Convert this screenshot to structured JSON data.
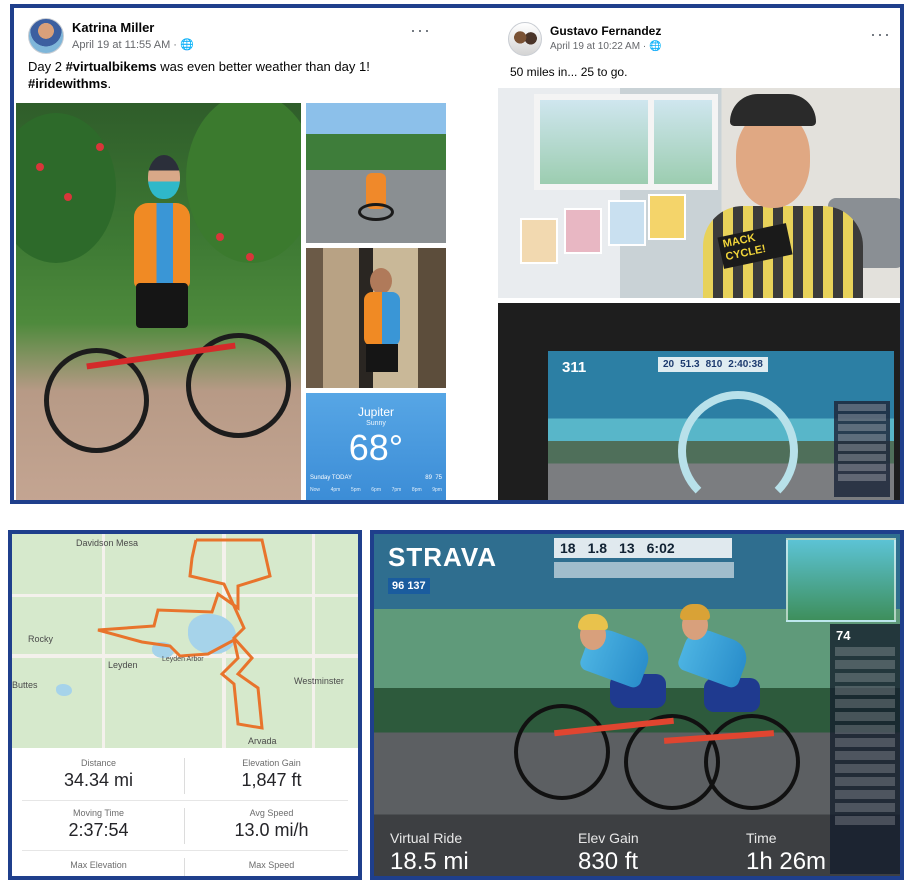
{
  "posts": [
    {
      "author": "Katrina Miller",
      "timestamp": "April 19 at 11:55 AM · ",
      "privacy_icon": "globe-icon",
      "more_label": "···",
      "text_prefix": "Day 2 ",
      "hashtag_1": "#virtualbikems",
      "text_middle": " was even better weather than day 1!",
      "hashtag_2": "#iridewithms",
      "text_suffix": ".",
      "weather": {
        "city": "Jupiter",
        "condition": "Sunny",
        "temperature": "68°",
        "day": "Sunday TODAY",
        "high": "89",
        "low": "75",
        "hours": [
          "Now",
          "4pm",
          "5pm",
          "6pm",
          "7pm",
          "8pm",
          "9pm"
        ]
      }
    },
    {
      "author": "Gustavo Fernandez",
      "timestamp": "April 19 at 10:22 AM · ",
      "privacy_icon": "globe-icon",
      "more_label": "···",
      "text": "50 miles in... 25 to go.",
      "shirt_text": "MACK CYCLE!",
      "hud": {
        "power": "311",
        "speed": "20",
        "distance": "51.3",
        "elevation": "810",
        "time": "2:40:38"
      }
    }
  ],
  "map_card": {
    "labels": [
      "Davidson Mesa",
      "Rocky",
      "Leyden",
      "Leyden Arbor",
      "Westminster",
      "Arvada",
      "Buttes"
    ],
    "route_color": "#e8742c",
    "stats": [
      {
        "label": "Distance",
        "value": "34.34 mi"
      },
      {
        "label": "Elevation Gain",
        "value": "1,847 ft"
      },
      {
        "label": "Moving Time",
        "value": "2:37:54"
      },
      {
        "label": "Avg Speed",
        "value": "13.0 mi/h"
      },
      {
        "label": "Max Elevation",
        "value": ""
      },
      {
        "label": "Max Speed",
        "value": ""
      }
    ]
  },
  "strava_card": {
    "logo": "STRAVA",
    "hud_power": "96",
    "hud_hr": "137",
    "hud_speed": "18",
    "hud_distance": "1.8",
    "hud_climb": "13",
    "hud_time": "6:02",
    "leaderboard_rank": "74",
    "stats": [
      {
        "label": "Virtual Ride",
        "value": "18.5 mi"
      },
      {
        "label": "Elev Gain",
        "value": "830 ft"
      },
      {
        "label": "Time",
        "value": "1h 26m"
      }
    ]
  },
  "colors": {
    "border": "#1f3f8c",
    "strava_orange": "#fc4c02",
    "facebook_text": "#050505",
    "meta_text": "#65676b"
  }
}
